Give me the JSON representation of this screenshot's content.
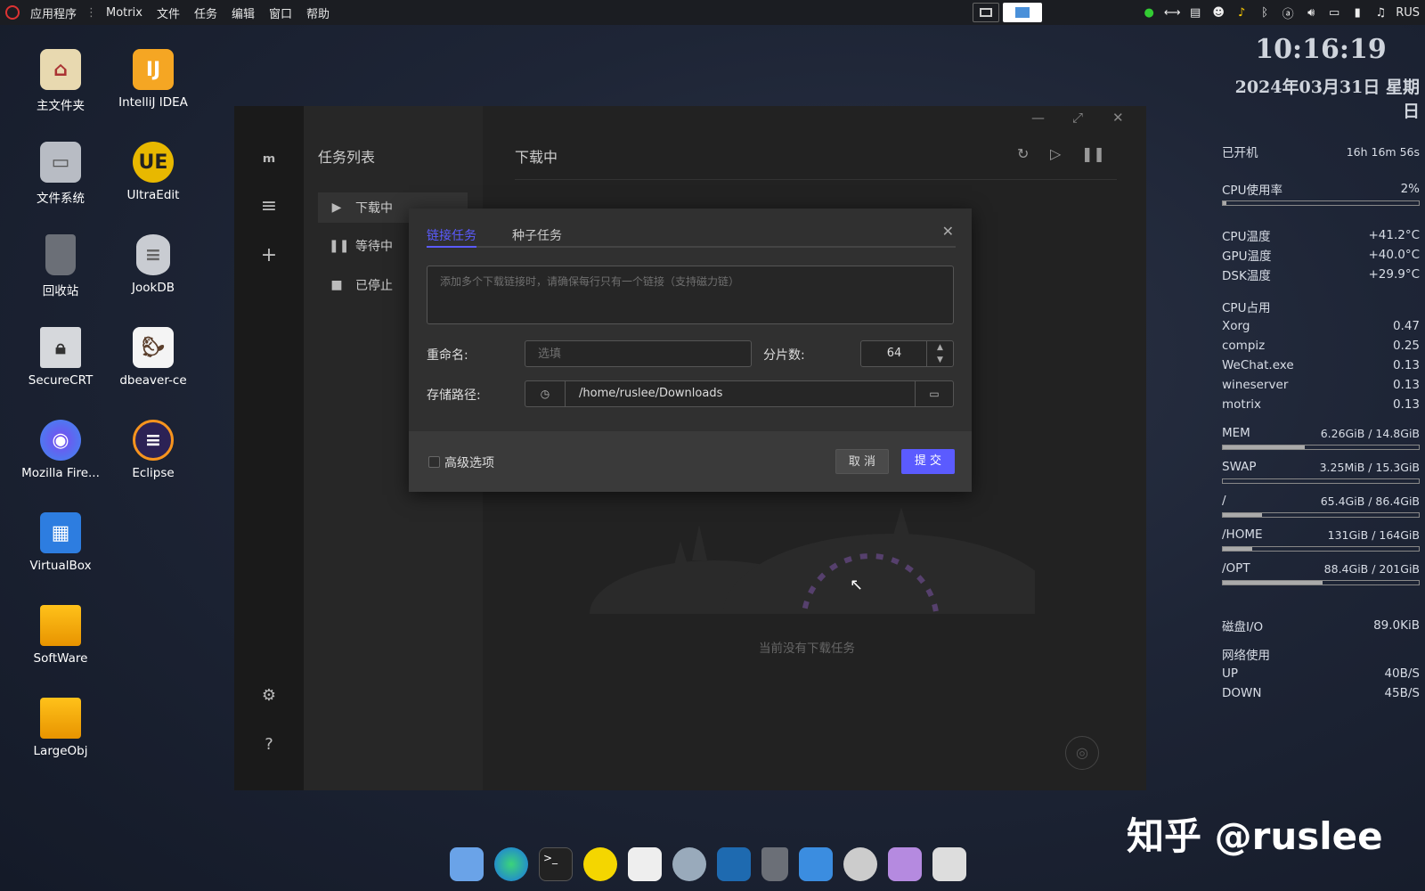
{
  "topbar": {
    "menus": [
      "应用程序",
      "Motrix",
      "文件",
      "任务",
      "编辑",
      "窗口",
      "帮助"
    ],
    "tray_lang": "RUS"
  },
  "desktop_icons": [
    {
      "label": "主文件夹",
      "icon": "home-folder-icon",
      "color": "#e8d9b0"
    },
    {
      "label": "IntelliJ IDEA",
      "icon": "intellij-icon",
      "color": "#f5a623"
    },
    {
      "label": "文件系统",
      "icon": "hard-drive-icon",
      "color": "#b8bcc4"
    },
    {
      "label": "UltraEdit",
      "icon": "ultraedit-icon",
      "color": "#e8b800"
    },
    {
      "label": "回收站",
      "icon": "trash-icon",
      "color": "#6b6f77"
    },
    {
      "label": "JookDB",
      "icon": "database-icon",
      "color": "#c9ccd2"
    },
    {
      "label": "SecureCRT",
      "icon": "securecrt-icon",
      "color": "#d6d8dc"
    },
    {
      "label": "dbeaver-ce",
      "icon": "dbeaver-icon",
      "color": "#f4f4f4"
    },
    {
      "label": "Mozilla Fire...",
      "icon": "firefox-icon",
      "color": "#5a6cf0"
    },
    {
      "label": "Eclipse",
      "icon": "eclipse-icon",
      "color": "#2c2255"
    },
    {
      "label": "VirtualBox",
      "icon": "virtualbox-icon",
      "color": "#2d7de0"
    },
    {
      "label": "SoftWare",
      "icon": "folder-drive-icon",
      "color": "#f2a900"
    },
    {
      "label": "LargeObj",
      "icon": "folder-drive-icon",
      "color": "#f2a900"
    }
  ],
  "conky": {
    "time": "10:16:19",
    "date": "2024年03月31日 星期日",
    "uptime_label": "已开机",
    "uptime": "16h 16m 56s",
    "cpu_label": "CPU使用率",
    "cpu": "2%",
    "cpu_fill": 0.02,
    "temps": [
      {
        "label": "CPU温度",
        "value": "+41.2°C"
      },
      {
        "label": "GPU温度",
        "value": "+40.0°C"
      },
      {
        "label": "DSK温度",
        "value": "+29.9°C"
      }
    ],
    "proc_label": "CPU占用",
    "procs": [
      {
        "label": "Xorg",
        "value": "0.47"
      },
      {
        "label": "compiz",
        "value": "0.25"
      },
      {
        "label": "WeChat.exe",
        "value": "0.13"
      },
      {
        "label": "wineserver",
        "value": "0.13"
      },
      {
        "label": "motrix",
        "value": "0.13"
      }
    ],
    "usage": [
      {
        "label": "MEM",
        "value": "6.26GiB / 14.8GiB",
        "fill": 0.42
      },
      {
        "label": "SWAP",
        "value": "3.25MiB / 15.3GiB",
        "fill": 0.0
      },
      {
        "label": "/",
        "value": "65.4GiB / 86.4GiB",
        "fill": 0.2
      },
      {
        "label": "/HOME",
        "value": "131GiB / 164GiB",
        "fill": 0.15
      },
      {
        "label": "/OPT",
        "value": "88.4GiB / 201GiB",
        "fill": 0.51
      }
    ],
    "disk_label": "磁盘I/O",
    "disk": "89.0KiB",
    "net_label": "网络使用",
    "up_label": "UP",
    "up": "40B/S",
    "down_label": "DOWN",
    "down": "45B/S"
  },
  "motrix": {
    "task_list_title": "任务列表",
    "tasks": [
      {
        "label": "下载中",
        "icon": "play-icon"
      },
      {
        "label": "等待中",
        "icon": "pause-icon"
      },
      {
        "label": "已停止",
        "icon": "stop-icon"
      }
    ],
    "main_title": "下载中",
    "empty_text": "当前没有下载任务"
  },
  "dialog": {
    "tab_link": "链接任务",
    "tab_torrent": "种子任务",
    "link_placeholder": "添加多个下载链接时，请确保每行只有一个链接（支持磁力链）",
    "rename_label": "重命名:",
    "rename_placeholder": "选填",
    "split_label": "分片数:",
    "split_value": "64",
    "path_label": "存储路径:",
    "path_value": "/home/ruslee/Downloads",
    "advanced_label": "高级选项",
    "cancel_label": "取 消",
    "submit_label": "提 交",
    "accent": "#5b5bff"
  },
  "watermark": "知乎 @ruslee"
}
